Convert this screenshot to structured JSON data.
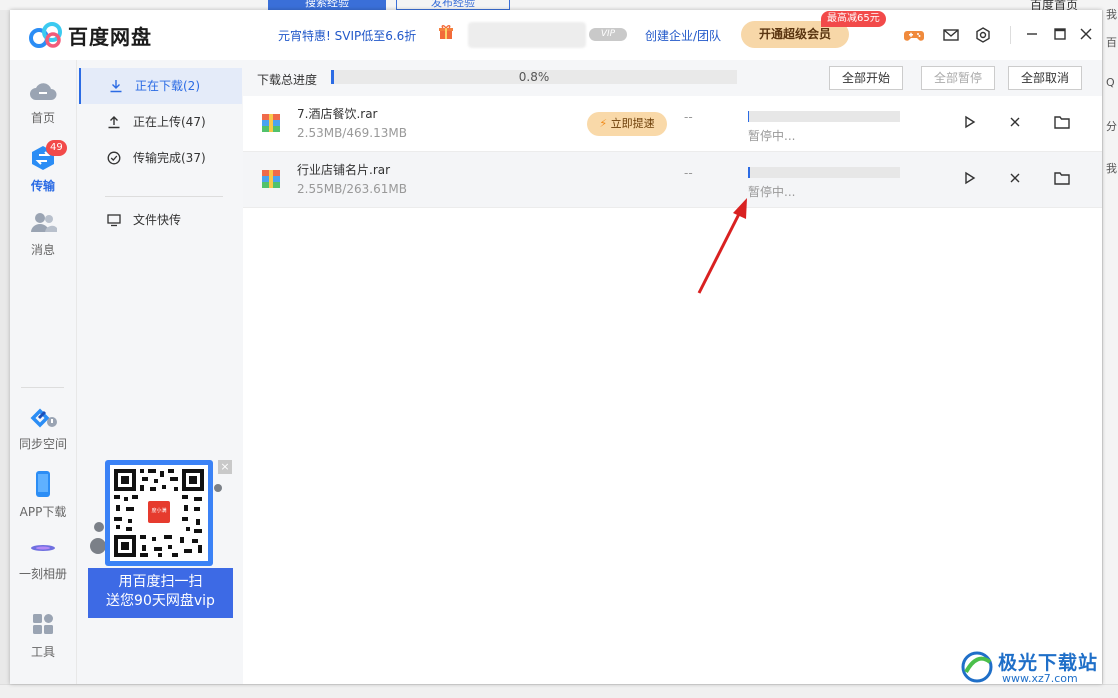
{
  "background": {
    "tabs": [
      "搜索经验",
      "发布经验"
    ],
    "right_text": "百度首页",
    "edge_chars": [
      "我",
      "百",
      "Q",
      "分",
      "我"
    ]
  },
  "titlebar": {
    "brand": "百度网盘",
    "promo": "元宵特惠! SVIP低至6.6折",
    "vip_badge": "VIP",
    "enterprise": "创建企业/团队",
    "svip_button": "开通超级会员",
    "svip_tag": "最高减65元"
  },
  "leftnav": {
    "items": [
      {
        "label": "首页",
        "icon": "cloud-home-icon"
      },
      {
        "label": "传输",
        "icon": "transfer-icon",
        "badge": "49"
      },
      {
        "label": "消息",
        "icon": "message-icon"
      },
      {
        "label": "同步空间",
        "icon": "sync-space-icon"
      },
      {
        "label": "APP下载",
        "icon": "phone-icon"
      },
      {
        "label": "一刻相册",
        "icon": "album-icon"
      },
      {
        "label": "工具",
        "icon": "tools-icon"
      }
    ]
  },
  "subnav": {
    "items": [
      {
        "label": "正在下载(2)",
        "icon": "download-icon"
      },
      {
        "label": "正在上传(47)",
        "icon": "upload-icon"
      },
      {
        "label": "传输完成(37)",
        "icon": "check-circle-icon"
      },
      {
        "label": "文件快传",
        "icon": "monitor-icon"
      }
    ]
  },
  "ad": {
    "line1": "用百度扫一扫",
    "line2": "送您90天网盘vip",
    "close": "×",
    "qr_center": "度小满"
  },
  "toolbar": {
    "label": "下载总进度",
    "progress_text": "0.8%",
    "progress": 0.008,
    "start_all": "全部开始",
    "pause_all": "全部暂停",
    "cancel_all": "全部取消"
  },
  "downloads": [
    {
      "name": "7.酒店餐饮.rar",
      "size": "2.53MB/469.13MB",
      "speed_button": "立即提速",
      "rate": "--",
      "status": "暂停中...",
      "progress": 0.005
    },
    {
      "name": "行业店铺名片.rar",
      "size": "2.55MB/263.61MB",
      "rate": "--",
      "status": "暂停中...",
      "progress": 0.01
    }
  ],
  "watermark": {
    "title": "极光下载站",
    "url": "www.xz7.com"
  },
  "colors": {
    "accent": "#2b6be4",
    "svip": "#f7d7a8",
    "badge": "#f24a4a"
  }
}
